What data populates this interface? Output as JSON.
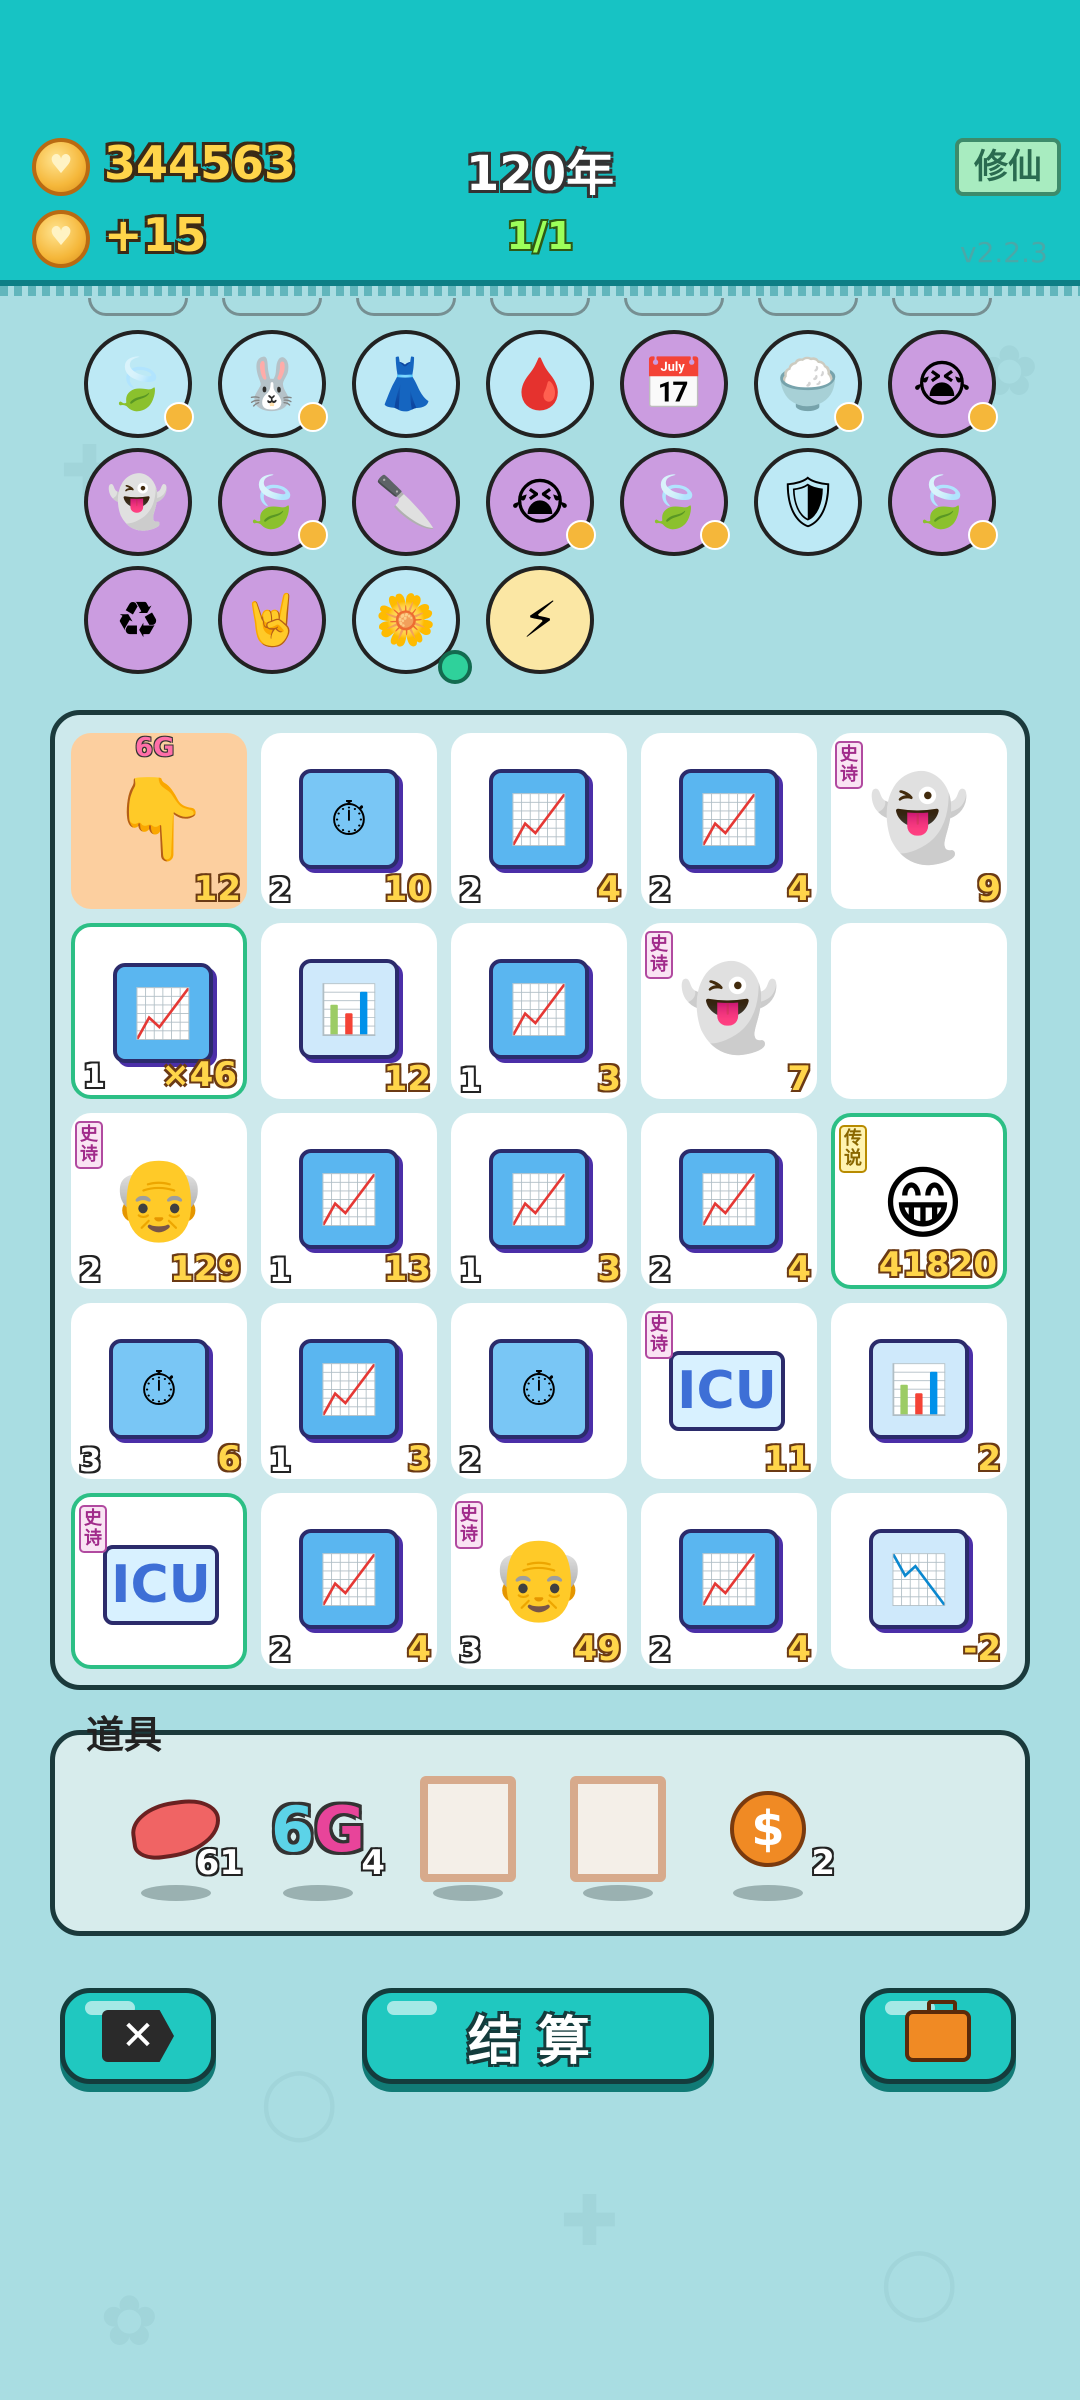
{
  "header": {
    "coins": "344563",
    "income": "+15",
    "year": "120年",
    "turn": "1/1",
    "mode_button": "修仙",
    "version": "v2.2.3"
  },
  "bag_icons": [
    {
      "name": "leaf-icon",
      "glyph": "🍃",
      "color": "blue",
      "heart": true
    },
    {
      "name": "rabbit-icon",
      "glyph": "🐰",
      "color": "blue",
      "heart": true
    },
    {
      "name": "skirt-icon",
      "glyph": "👗",
      "color": "blue",
      "heart": false
    },
    {
      "name": "blood-bag-icon",
      "glyph": "🩸",
      "color": "blue",
      "heart": false
    },
    {
      "name": "calendar-icon",
      "glyph": "📅",
      "color": "purple",
      "heart": false
    },
    {
      "name": "rice-bowl-icon",
      "glyph": "🍚",
      "color": "blue",
      "heart": true
    },
    {
      "name": "crying-face-icon",
      "glyph": "😭",
      "color": "purple",
      "heart": true
    },
    {
      "name": "ghost-traffic-icon",
      "glyph": "👻",
      "color": "purple",
      "heart": false
    },
    {
      "name": "leaf-icon",
      "glyph": "🍃",
      "color": "purple",
      "heart": true
    },
    {
      "name": "cleaver-icon",
      "glyph": "🔪",
      "color": "purple",
      "heart": false
    },
    {
      "name": "crying-face-icon",
      "glyph": "😭",
      "color": "purple",
      "heart": true
    },
    {
      "name": "leaf-icon",
      "glyph": "🍃",
      "color": "purple",
      "heart": true
    },
    {
      "name": "shield-wrench-icon",
      "glyph": "🛡",
      "color": "blue",
      "heart": false
    },
    {
      "name": "leaf-icon",
      "glyph": "🍃",
      "color": "purple",
      "heart": true
    },
    {
      "name": "recycle-icon",
      "glyph": "♻",
      "color": "purple",
      "heart": false
    },
    {
      "name": "rock-hand-icon",
      "glyph": "🤘",
      "color": "purple",
      "heart": false
    },
    {
      "name": "flower-pot-icon",
      "glyph": "🌼",
      "color": "blue",
      "heart": false,
      "dot": true
    },
    {
      "name": "lightning-icon",
      "glyph": "⚡",
      "color": "gold",
      "heart": false
    }
  ],
  "board": [
    [
      {
        "kind": "hand",
        "glyph": "👇",
        "lv": "",
        "val": "12",
        "bg": "peach",
        "tag6g": "6G"
      },
      {
        "kind": "clock",
        "glyph": "⏱",
        "lv": "2",
        "val": "10"
      },
      {
        "kind": "growth",
        "glyph": "📈",
        "lv": "2",
        "val": "4"
      },
      {
        "kind": "growth",
        "glyph": "📈",
        "lv": "2",
        "val": "4"
      },
      {
        "kind": "ghost",
        "glyph": "👻",
        "lv": "",
        "val": "9",
        "tag": "史诗"
      }
    ],
    [
      {
        "kind": "growth",
        "glyph": "📈",
        "lv": "1",
        "val": "×46",
        "selected": true
      },
      {
        "kind": "chart-up",
        "glyph": "📊",
        "lv": "",
        "val": "12"
      },
      {
        "kind": "growth",
        "glyph": "📈",
        "lv": "1",
        "val": "3"
      },
      {
        "kind": "ghost",
        "glyph": "👻",
        "lv": "",
        "val": "7",
        "tag": "史诗"
      },
      {
        "kind": "empty",
        "glyph": "",
        "lv": "",
        "val": ""
      }
    ],
    [
      {
        "kind": "face",
        "glyph": "👴",
        "lv": "2",
        "val": "129",
        "tag": "史诗"
      },
      {
        "kind": "growth",
        "glyph": "📈",
        "lv": "1",
        "val": "13"
      },
      {
        "kind": "growth",
        "glyph": "📈",
        "lv": "1",
        "val": "3"
      },
      {
        "kind": "growth",
        "glyph": "📈",
        "lv": "2",
        "val": "4"
      },
      {
        "kind": "face",
        "glyph": "😁",
        "lv": "",
        "val": "41820",
        "tag": "传说",
        "legend": true,
        "selected": true
      }
    ],
    [
      {
        "kind": "clock",
        "glyph": "⏱",
        "lv": "3",
        "val": "6"
      },
      {
        "kind": "growth",
        "glyph": "📈",
        "lv": "1",
        "val": "3"
      },
      {
        "kind": "clock",
        "glyph": "⏱",
        "lv": "2",
        "val": ""
      },
      {
        "kind": "icu",
        "glyph": "ICU",
        "lv": "",
        "val": "11",
        "tag": "史诗"
      },
      {
        "kind": "chart-up",
        "glyph": "📊",
        "lv": "",
        "val": "2"
      }
    ],
    [
      {
        "kind": "icu",
        "glyph": "ICU",
        "lv": "",
        "val": "",
        "tag": "史诗",
        "selected": true
      },
      {
        "kind": "growth",
        "glyph": "📈",
        "lv": "2",
        "val": "4"
      },
      {
        "kind": "face",
        "glyph": "👴",
        "lv": "3",
        "val": "49",
        "tag": "史诗"
      },
      {
        "kind": "growth",
        "glyph": "📈",
        "lv": "2",
        "val": "4"
      },
      {
        "kind": "chart-down",
        "glyph": "📉",
        "lv": "",
        "val": "-2"
      }
    ]
  ],
  "props": {
    "title": "道具",
    "items": [
      {
        "name": "liver-item",
        "count": "61"
      },
      {
        "name": "6g-item",
        "label_a": "6",
        "label_b": "G",
        "count": "4"
      },
      {
        "name": "empty-slot",
        "count": ""
      },
      {
        "name": "empty-slot",
        "count": ""
      },
      {
        "name": "dollar-coin-item",
        "glyph": "$",
        "count": "2"
      }
    ]
  },
  "buttons": {
    "close_glyph": "✕",
    "settle": "结算"
  },
  "colors": {
    "header": "#17c3c4",
    "background": "#a9dde2",
    "gold_text": "#ffd54a",
    "button": "#20c8c0"
  }
}
